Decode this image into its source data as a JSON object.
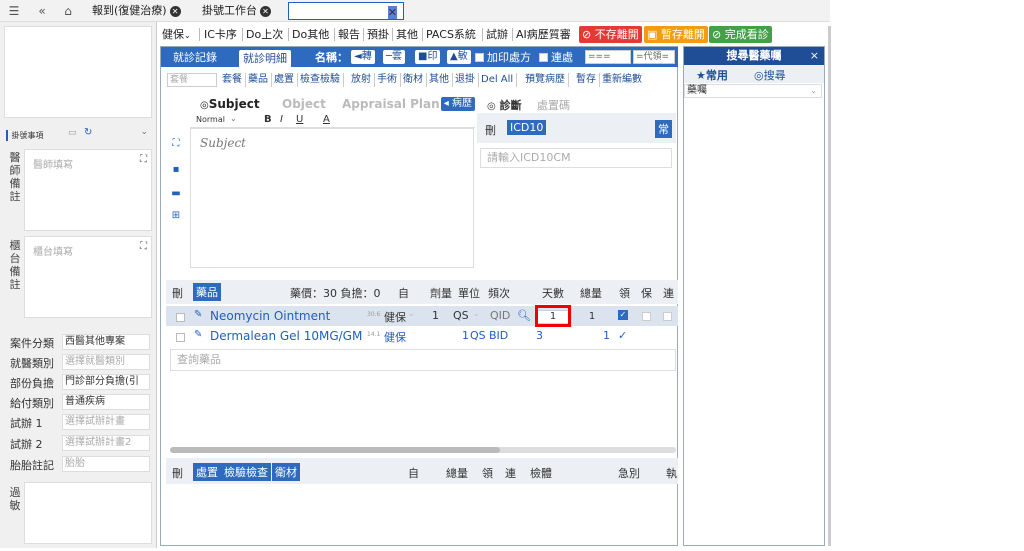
{
  "topbar": {
    "tabs": [
      {
        "label": "報到(復健治療)"
      },
      {
        "label": "掛號工作台"
      },
      {
        "label": ""
      }
    ]
  },
  "left": {
    "header": "掛號事項",
    "doctor_note_label": "醫師備註",
    "doctor_note_placeholder": "醫師填寫",
    "counter_note_label": "櫃台備註",
    "counter_note_placeholder": "櫃台填寫",
    "fields": [
      {
        "label": "案件分類",
        "value": "西醫其他專案",
        "placeholder": false
      },
      {
        "label": "就醫類別",
        "value": "選擇就醫類別",
        "placeholder": true
      },
      {
        "label": "部份負擔",
        "value": "門診部分負擔(引",
        "placeholder": false
      },
      {
        "label": "給付類別",
        "value": "普通疾病",
        "placeholder": false
      },
      {
        "label": "試辦 1",
        "value": "選擇試辦計畫",
        "placeholder": true
      },
      {
        "label": "試辦 2",
        "value": "選擇試辦計畫2",
        "placeholder": true
      },
      {
        "label": "胎胎註記",
        "value": "胎胎",
        "placeholder": true
      }
    ],
    "allergy_label": "過敏"
  },
  "toolbar": {
    "items": [
      "健保",
      "IC卡序",
      "Do上次",
      "Do其他",
      "報告",
      "預掛",
      "其他",
      "PACS系統",
      "試辦",
      "AI病歷質審"
    ],
    "no_save_leave": "不存離開",
    "temp_save_leave": "暫存離開",
    "finish": "完成看診"
  },
  "main": {
    "tabs": [
      "就診記錄",
      "就診明細"
    ],
    "name_label": "名稱：",
    "name_btns": [
      "◄轉",
      "─雲",
      "■印",
      "▲敏"
    ],
    "add_rx": "加印處方",
    "continuous": "連處",
    "sel1": "===",
    "sel2": "=代領=",
    "subbar": [
      "套餐",
      "藥品",
      "處置",
      "檢查檢驗",
      "放射",
      "手術",
      "衛材",
      "其他",
      "退掛",
      "Del All",
      "預覽病歷",
      "暫存",
      "重新編數"
    ],
    "subbar_input": "套餐"
  },
  "editor": {
    "tabs": [
      "Subject",
      "Object",
      "Appraisal Plan"
    ],
    "btn": "病歷",
    "format": "Normal",
    "placeholder": "Subject"
  },
  "diagnosis": {
    "tab1": "診斷",
    "tab2": "處置碼",
    "del": "刪",
    "code_label": "ICD10",
    "common": "常",
    "placeholder": "請輸入ICD10CM"
  },
  "drugs": {
    "del": "刪",
    "tag": "藥品",
    "summary": "藥價：30 負擔：0",
    "headers": [
      "自",
      "劑量",
      "單位",
      "頻次",
      "天數",
      "總量",
      "領",
      "保",
      "連"
    ],
    "rows": [
      {
        "name": "Neomycin Ointment",
        "sub": "30.6",
        "self": "健保",
        "dose": "1",
        "unit": "QS",
        "freq": "QID",
        "days": "1",
        "total": "1"
      },
      {
        "name": "Dermalean Gel 10MG/GM",
        "sub": "14.1",
        "self": "健保",
        "dose": "1",
        "unit": "QS",
        "freq": "BID",
        "days": "3",
        "total": "1"
      }
    ],
    "search_placeholder": "查詢藥品"
  },
  "services": {
    "del": "刪",
    "tags": [
      "處置",
      "檢驗檢查",
      "衛材"
    ],
    "headers": [
      "自",
      "總量",
      "領",
      "連",
      "檢體",
      "急別",
      "執"
    ]
  },
  "right": {
    "title": "搜尋醫藥囑",
    "close": "×",
    "tab_common": "★常用",
    "tab_search": "◎搜尋",
    "select_value": "藥囑"
  }
}
